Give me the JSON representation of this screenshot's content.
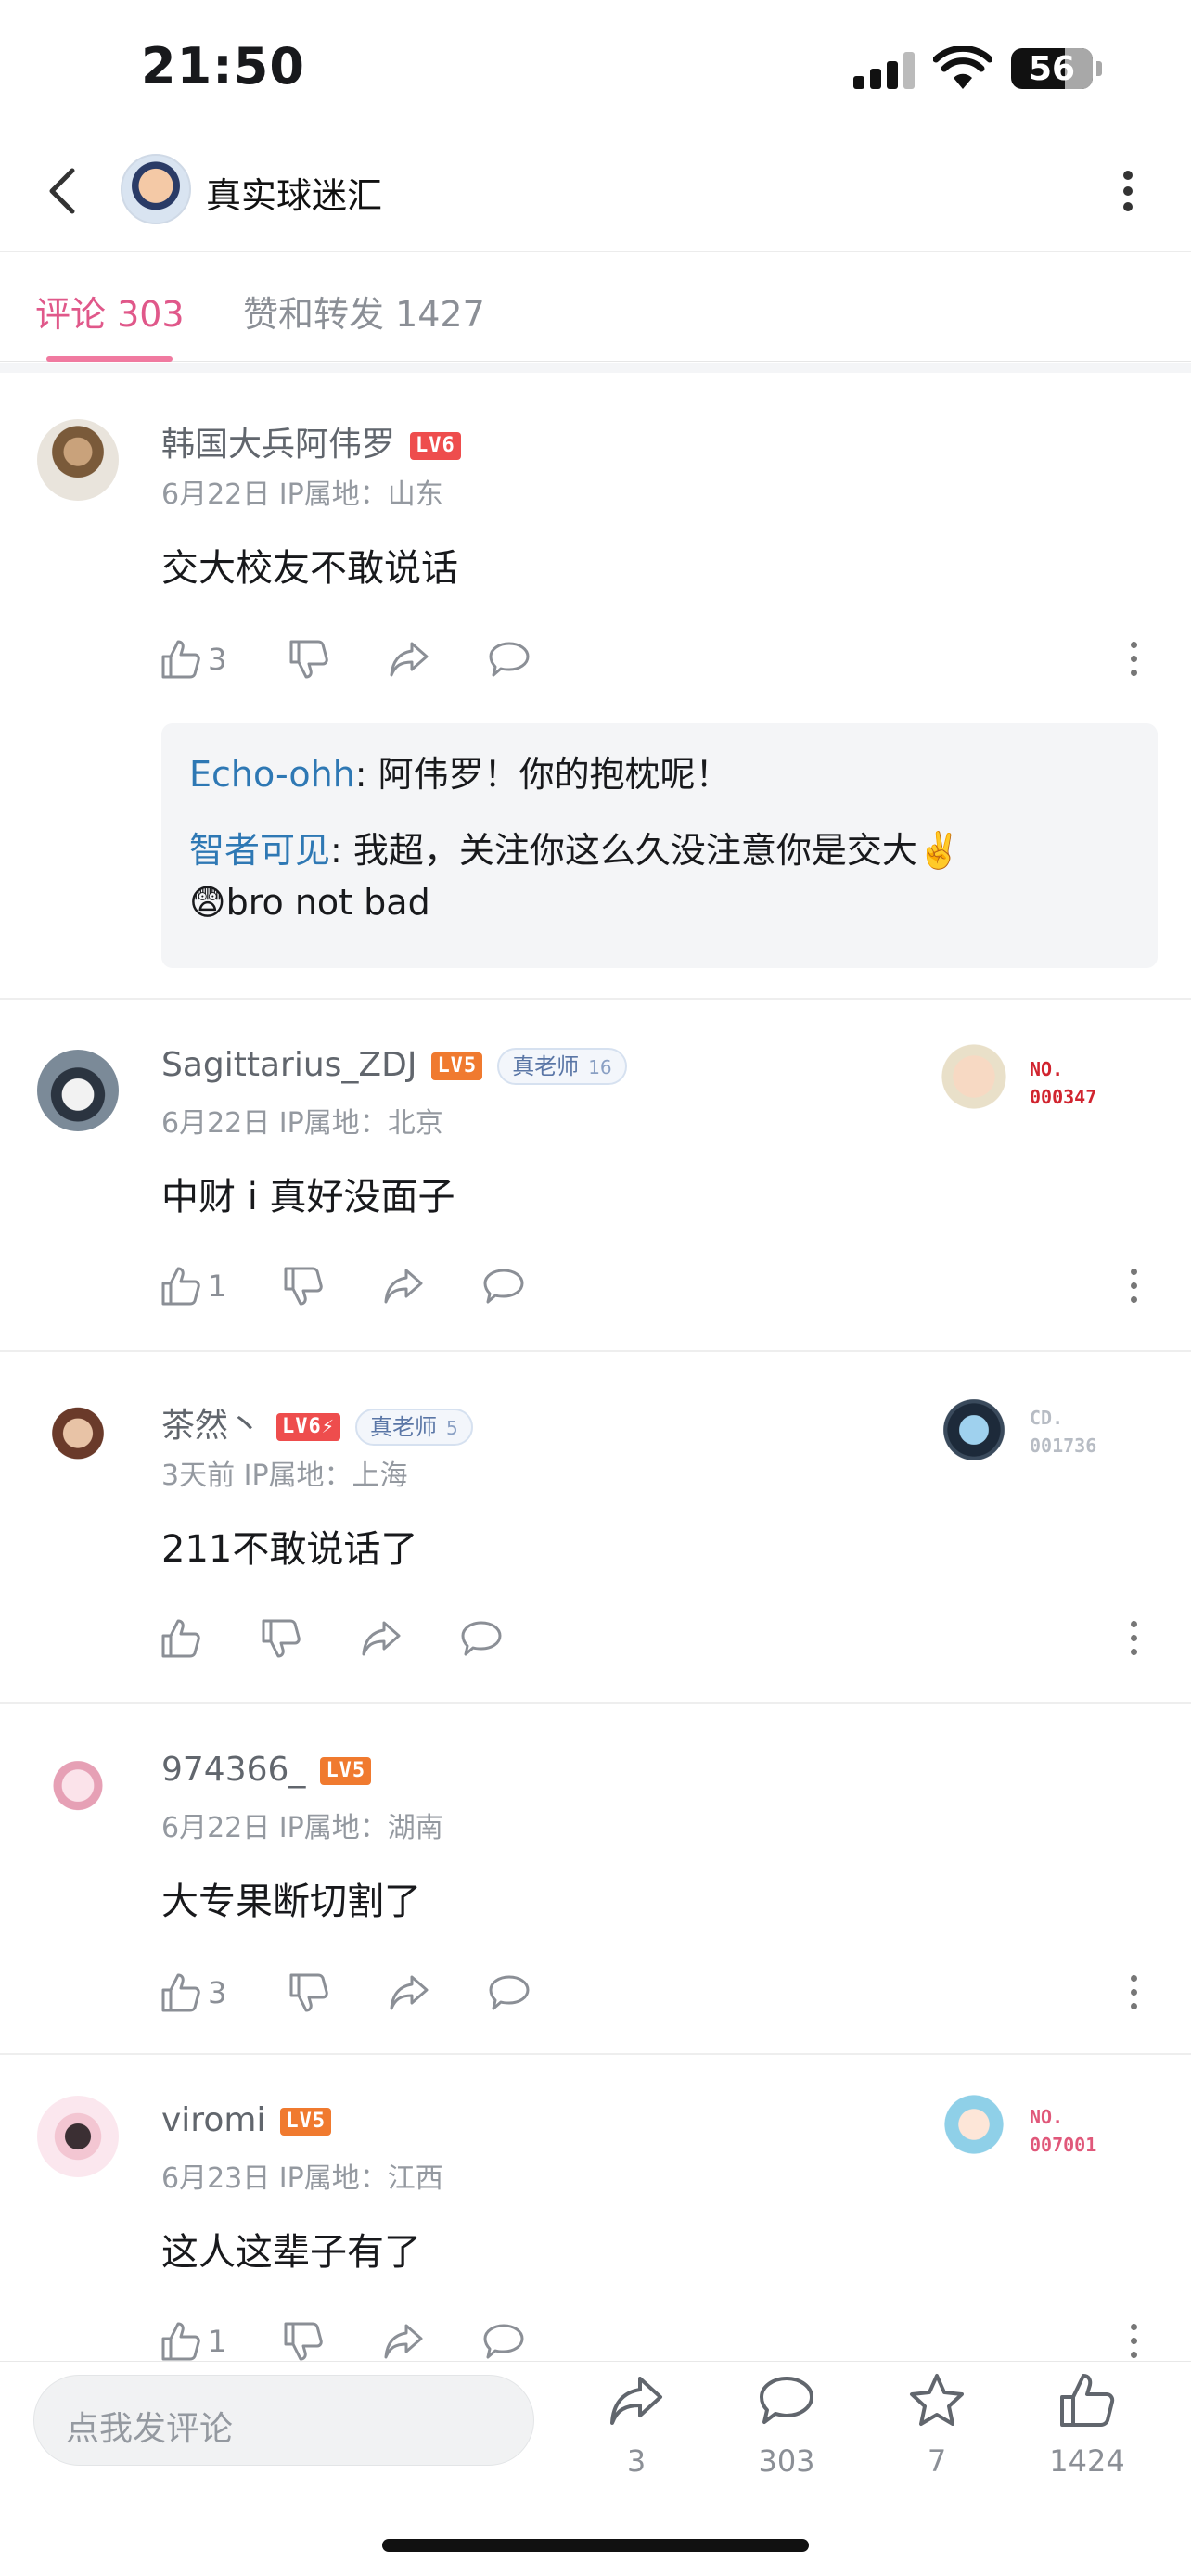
{
  "status_bar": {
    "time": "21:50",
    "battery": "56"
  },
  "nav": {
    "title": "真实球迷汇"
  },
  "tabs": {
    "comments": "评论 303",
    "likes_reposts": "赞和转发 1427"
  },
  "comments": [
    {
      "name": "韩国大兵阿伟罗",
      "level": "LV6",
      "meta": "6月22日  IP属地：山东",
      "text": "交大校友不敢说话",
      "likes": "3",
      "replies": [
        {
          "who": "Echo-ohh",
          "text": ": 阿伟罗！你的抱枕呢！"
        },
        {
          "who": "智者可见",
          "text": ": 我超，关注你这么久没注意你是交大✌️",
          "text2": "😨bro not bad"
        }
      ]
    },
    {
      "name": "Sagittarius_ZDJ",
      "level": "LV5",
      "badge": "真老师",
      "badge_num": "16",
      "meta": "6月22日  IP属地：北京",
      "text": "中财 i 真好没面子",
      "likes": "1",
      "fan_label_1": "NO.",
      "fan_label_2": "000347"
    },
    {
      "name": "茶然丶",
      "level": "LV6⚡",
      "badge": "真老师",
      "badge_num": "5",
      "meta": "3天前  IP属地：上海",
      "text": "211不敢说话了",
      "likes": "",
      "fan_label_1": "CD.",
      "fan_label_2": "001736"
    },
    {
      "name": "974366_",
      "level": "LV5",
      "meta": "6月22日  IP属地：湖南",
      "text": "大专果断切割了",
      "likes": "3"
    },
    {
      "name": "viromi",
      "level": "LV5",
      "meta": "6月23日  IP属地：江西",
      "text": "这人这辈子有了",
      "likes": "1",
      "fan_label_1": "NO.",
      "fan_label_2": "007001"
    }
  ],
  "bottom": {
    "placeholder": "点我发评论",
    "share_count": "3",
    "comment_count": "303",
    "fav_count": "7",
    "like_count": "1424"
  },
  "colors": {
    "accent_pink": "#e0588a",
    "link_blue": "#2e78b4",
    "lv6": "#ee4d4d",
    "lv5": "#f07a2f"
  },
  "icons": [
    "back-icon",
    "more-icon",
    "thumb-up-icon",
    "thumb-down-icon",
    "share-icon",
    "reply-icon",
    "star-icon",
    "signal-icon",
    "wifi-icon",
    "battery-icon"
  ]
}
